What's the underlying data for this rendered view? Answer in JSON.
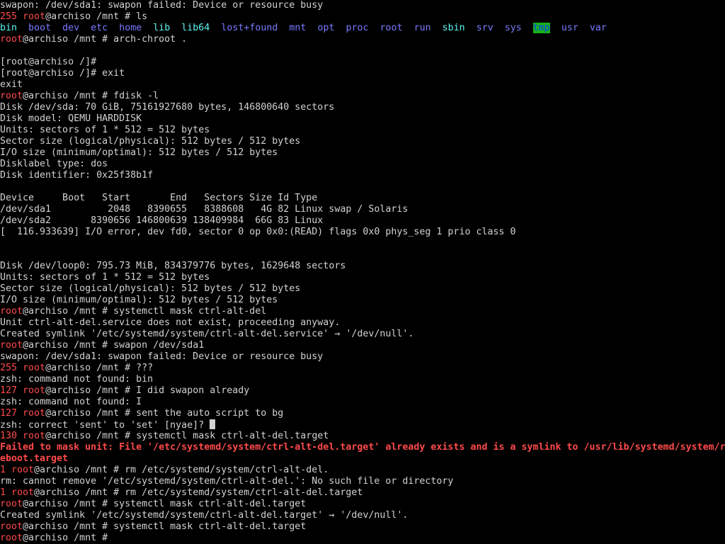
{
  "colors": {
    "background": "#000000",
    "text": "#d2d2d2",
    "prompt_user": "#ff4a4a",
    "directory": "#7a7aff",
    "link": "#5ff5f5",
    "sticky_dir_fg": "#0a3aff",
    "sticky_dir_bg": "#18b218",
    "error": "#ff4a4a"
  },
  "lines": [
    [
      {
        "t": "swapon: /dev/sda1: swapon failed: Device or resource busy",
        "c": "white"
      }
    ],
    [
      {
        "t": "255 ",
        "c": "red"
      },
      {
        "t": "root",
        "c": "red"
      },
      {
        "t": "@archiso /mnt # ls",
        "c": "white"
      }
    ],
    [
      {
        "t": "bin",
        "c": "cyan"
      },
      {
        "t": "  ",
        "c": "white"
      },
      {
        "t": "boot",
        "c": "blue"
      },
      {
        "t": "  ",
        "c": "white"
      },
      {
        "t": "dev",
        "c": "blue"
      },
      {
        "t": "  ",
        "c": "white"
      },
      {
        "t": "etc",
        "c": "blue"
      },
      {
        "t": "  ",
        "c": "white"
      },
      {
        "t": "home",
        "c": "blue"
      },
      {
        "t": "  ",
        "c": "white"
      },
      {
        "t": "lib",
        "c": "cyan"
      },
      {
        "t": "  ",
        "c": "white"
      },
      {
        "t": "lib64",
        "c": "cyan"
      },
      {
        "t": "  ",
        "c": "white"
      },
      {
        "t": "lost+found",
        "c": "blue"
      },
      {
        "t": "  ",
        "c": "white"
      },
      {
        "t": "mnt",
        "c": "blue"
      },
      {
        "t": "  ",
        "c": "white"
      },
      {
        "t": "opt",
        "c": "blue"
      },
      {
        "t": "  ",
        "c": "white"
      },
      {
        "t": "proc",
        "c": "blue"
      },
      {
        "t": "  ",
        "c": "white"
      },
      {
        "t": "root",
        "c": "blue"
      },
      {
        "t": "  ",
        "c": "white"
      },
      {
        "t": "run",
        "c": "blue"
      },
      {
        "t": "  ",
        "c": "white"
      },
      {
        "t": "sbin",
        "c": "cyan"
      },
      {
        "t": "  ",
        "c": "white"
      },
      {
        "t": "srv",
        "c": "blue"
      },
      {
        "t": "  ",
        "c": "white"
      },
      {
        "t": "sys",
        "c": "blue"
      },
      {
        "t": "  ",
        "c": "white"
      },
      {
        "t": "tmp",
        "c": "tmp"
      },
      {
        "t": "  ",
        "c": "white"
      },
      {
        "t": "usr",
        "c": "blue"
      },
      {
        "t": "  ",
        "c": "white"
      },
      {
        "t": "var",
        "c": "blue"
      }
    ],
    [
      {
        "t": "root",
        "c": "red"
      },
      {
        "t": "@archiso /mnt # arch-chroot .",
        "c": "white"
      }
    ],
    [
      {
        "t": "",
        "c": "white"
      }
    ],
    [
      {
        "t": "[root@archiso /]#",
        "c": "white"
      }
    ],
    [
      {
        "t": "[root@archiso /]# exit",
        "c": "white"
      }
    ],
    [
      {
        "t": "exit",
        "c": "white"
      }
    ],
    [
      {
        "t": "root",
        "c": "red"
      },
      {
        "t": "@archiso /mnt # fdisk -l",
        "c": "white"
      }
    ],
    [
      {
        "t": "Disk /dev/sda: 70 GiB, 75161927680 bytes, 146800640 sectors",
        "c": "white"
      }
    ],
    [
      {
        "t": "Disk model: QEMU HARDDISK",
        "c": "white"
      }
    ],
    [
      {
        "t": "Units: sectors of 1 * 512 = 512 bytes",
        "c": "white"
      }
    ],
    [
      {
        "t": "Sector size (logical/physical): 512 bytes / 512 bytes",
        "c": "white"
      }
    ],
    [
      {
        "t": "I/O size (minimum/optimal): 512 bytes / 512 bytes",
        "c": "white"
      }
    ],
    [
      {
        "t": "Disklabel type: dos",
        "c": "white"
      }
    ],
    [
      {
        "t": "Disk identifier: 0x25f38b1f",
        "c": "white"
      }
    ],
    [
      {
        "t": "",
        "c": "white"
      }
    ],
    [
      {
        "t": "Device     Boot   Start       End   Sectors Size Id Type",
        "c": "white"
      }
    ],
    [
      {
        "t": "/dev/sda1          2048   8390655   8388608   4G 82 Linux swap / Solaris",
        "c": "white"
      }
    ],
    [
      {
        "t": "/dev/sda2       8390656 146800639 138409984  66G 83 Linux",
        "c": "white"
      }
    ],
    [
      {
        "t": "[  116.933639] I/O error, dev fd0, sector 0 op 0x0:(READ) flags 0x0 phys_seg 1 prio class 0",
        "c": "white"
      }
    ],
    [
      {
        "t": "",
        "c": "white"
      }
    ],
    [
      {
        "t": "",
        "c": "white"
      }
    ],
    [
      {
        "t": "Disk /dev/loop0: 795.73 MiB, 834379776 bytes, 1629648 sectors",
        "c": "white"
      }
    ],
    [
      {
        "t": "Units: sectors of 1 * 512 = 512 bytes",
        "c": "white"
      }
    ],
    [
      {
        "t": "Sector size (logical/physical): 512 bytes / 512 bytes",
        "c": "white"
      }
    ],
    [
      {
        "t": "I/O size (minimum/optimal): 512 bytes / 512 bytes",
        "c": "white"
      }
    ],
    [
      {
        "t": "root",
        "c": "red"
      },
      {
        "t": "@archiso /mnt # systemctl mask ctrl-alt-del",
        "c": "white"
      }
    ],
    [
      {
        "t": "Unit ctrl-alt-del.service does not exist, proceeding anyway.",
        "c": "white"
      }
    ],
    [
      {
        "t": "Created symlink '/etc/systemd/system/ctrl-alt-del.service' → '/dev/null'.",
        "c": "white"
      }
    ],
    [
      {
        "t": "root",
        "c": "red"
      },
      {
        "t": "@archiso /mnt # swapon /dev/sda1",
        "c": "white"
      }
    ],
    [
      {
        "t": "swapon: /dev/sda1: swapon failed: Device or resource busy",
        "c": "white"
      }
    ],
    [
      {
        "t": "255 ",
        "c": "red"
      },
      {
        "t": "root",
        "c": "red"
      },
      {
        "t": "@archiso /mnt # ???",
        "c": "white"
      }
    ],
    [
      {
        "t": "zsh: command not found: bin",
        "c": "white"
      }
    ],
    [
      {
        "t": "127 ",
        "c": "red"
      },
      {
        "t": "root",
        "c": "red"
      },
      {
        "t": "@archiso /mnt # I did swapon already",
        "c": "white"
      }
    ],
    [
      {
        "t": "zsh: command not found: I",
        "c": "white"
      }
    ],
    [
      {
        "t": "127 ",
        "c": "red"
      },
      {
        "t": "root",
        "c": "red"
      },
      {
        "t": "@archiso /mnt # sent the auto script to bg",
        "c": "white"
      }
    ],
    [
      {
        "t": "zsh: correct 'sent' to 'set' [nyae]? ",
        "c": "white"
      },
      {
        "t": "",
        "c": "cursor"
      }
    ],
    [
      {
        "t": "130 ",
        "c": "red"
      },
      {
        "t": "root",
        "c": "red"
      },
      {
        "t": "@archiso /mnt # systemctl mask ctrl-alt-del.target",
        "c": "white"
      }
    ],
    [
      {
        "t": "Failed to mask unit: File '/etc/systemd/system/ctrl-alt-del.target' already exists and is a symlink to /usr/lib/systemd/system/r",
        "c": "redbold"
      }
    ],
    [
      {
        "t": "eboot.target",
        "c": "redbold"
      }
    ],
    [
      {
        "t": "1 ",
        "c": "red"
      },
      {
        "t": "root",
        "c": "red"
      },
      {
        "t": "@archiso /mnt # rm /etc/systemd/system/ctrl-alt-del.",
        "c": "white"
      }
    ],
    [
      {
        "t": "rm: cannot remove '/etc/systemd/system/ctrl-alt-del.': No such file or directory",
        "c": "white"
      }
    ],
    [
      {
        "t": "1 ",
        "c": "red"
      },
      {
        "t": "root",
        "c": "red"
      },
      {
        "t": "@archiso /mnt # rm /etc/systemd/system/ctrl-alt-del.target",
        "c": "white"
      }
    ],
    [
      {
        "t": "root",
        "c": "red"
      },
      {
        "t": "@archiso /mnt # systemctl mask ctrl-alt-del.target",
        "c": "white"
      }
    ],
    [
      {
        "t": "Created symlink '/etc/systemd/system/ctrl-alt-del.target' → '/dev/null'.",
        "c": "white"
      }
    ],
    [
      {
        "t": "root",
        "c": "red"
      },
      {
        "t": "@archiso /mnt # systemctl mask ctrl-alt-del.target",
        "c": "white"
      }
    ],
    [
      {
        "t": "root",
        "c": "red"
      },
      {
        "t": "@archiso /mnt # ",
        "c": "white"
      }
    ]
  ]
}
